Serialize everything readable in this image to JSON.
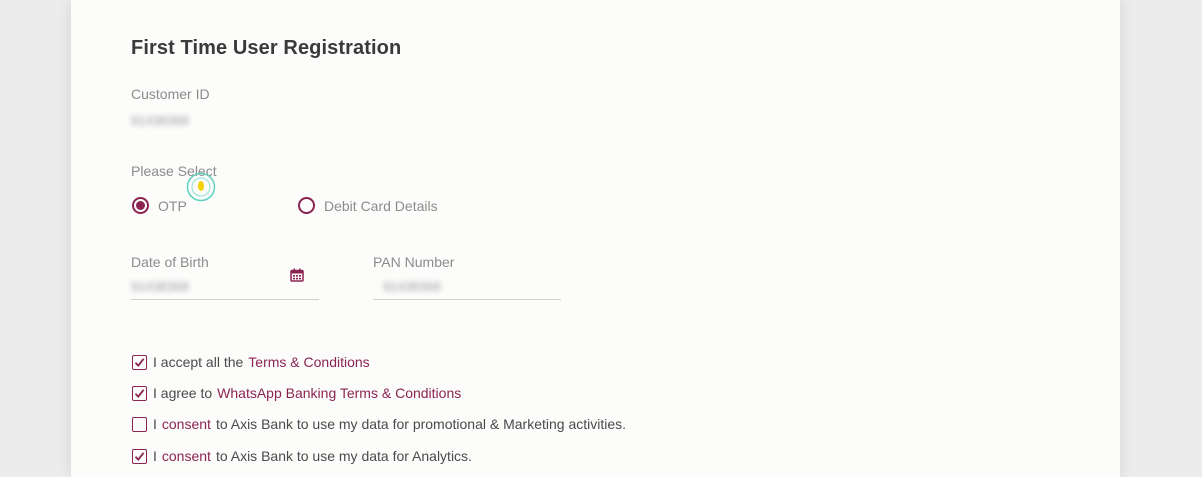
{
  "form": {
    "title": "First Time User Registration",
    "customer_id": {
      "label": "Customer ID",
      "value": "91438368"
    },
    "please_select": {
      "label": "Please Select",
      "options": [
        {
          "label": "OTP",
          "selected": true
        },
        {
          "label": "Debit Card Details",
          "selected": false
        }
      ]
    },
    "dob": {
      "label": "Date of Birth",
      "value": "91438368",
      "icon": "calendar-icon"
    },
    "pan": {
      "label": "PAN Number",
      "value": "91438368"
    }
  },
  "consents": [
    {
      "checked": true,
      "prefix": "I accept all the",
      "link": "Terms & Conditions",
      "suffix": ""
    },
    {
      "checked": true,
      "prefix": "I agree to",
      "link": "WhatsApp Banking Terms & Conditions",
      "suffix": ""
    },
    {
      "checked": false,
      "prefix": "I",
      "link": "consent",
      "suffix": "to Axis Bank to use my data for promotional & Marketing activities."
    },
    {
      "checked": true,
      "prefix": "I",
      "link": "consent",
      "suffix": "to Axis Bank to use my data for Analytics."
    }
  ],
  "colors": {
    "accent": "#8b2452",
    "page_bg": "#ececec",
    "card_bg": "#fcfcfb",
    "cursor": "#f2d200"
  }
}
